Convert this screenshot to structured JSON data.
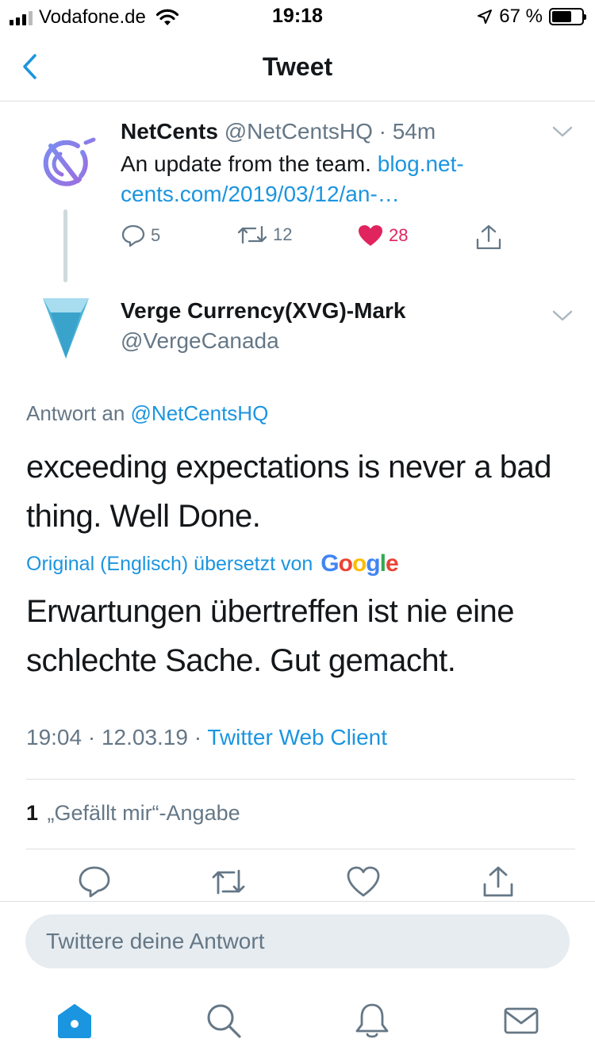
{
  "status_bar": {
    "carrier": "Vodafone.de",
    "time": "19:18",
    "battery": "67 %",
    "battery_level": 0.67
  },
  "nav": {
    "title": "Tweet",
    "back_icon": "chevron-left-icon"
  },
  "parent_tweet": {
    "name": "NetCents",
    "handle_time": "@NetCentsHQ · 54m",
    "text": "An update from the team.",
    "link": "blog.net-cents.com/2019/03/12/an-…",
    "replies": "5",
    "retweets": "12",
    "likes": "28"
  },
  "main_tweet": {
    "name": "Verge Currency(XVG)-Mark",
    "handle": "@VergeCanada",
    "replying_prefix": "Antwort an",
    "replying_to": "@NetCentsHQ",
    "text": "exceeding expectations is never a bad thing. Well Done.",
    "translated_by": "Original (Englisch) übersetzt von",
    "translation_text": "Erwartungen übertreffen ist nie eine schlechte Sache. Gut gemacht.",
    "time_date": "19:04 · 12.03.19 ·",
    "client": "Twitter Web Client",
    "likes_count": "1",
    "likes_label": "„Gefällt mir“-Angabe"
  },
  "google_logo": [
    "G",
    "o",
    "o",
    "g",
    "l",
    "e"
  ],
  "reply": {
    "placeholder": "Twittere deine Antwort"
  },
  "colors": {
    "accent": "#1b95e0",
    "like": "#e0245e",
    "muted": "#657786",
    "text": "#14171a"
  }
}
